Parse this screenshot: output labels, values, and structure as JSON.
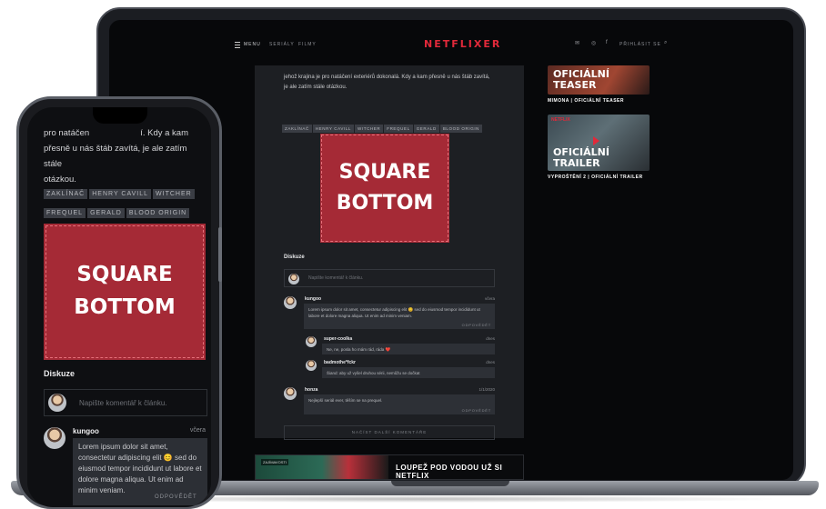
{
  "nav": {
    "menu_label": "MENU",
    "items": [
      "SERIÁLY",
      "FILMY"
    ],
    "logo": "NETFLIXER",
    "login_label": "PŘIHLÁSIT SE"
  },
  "article": {
    "paragraph": "jehož krajina je pro natáčení exteriérů dokonalá. Kdy a kam přesně u nás štáb zavítá, je ale zatím stále otázkou.",
    "tags": [
      "ZAKLÍNAČ",
      "HENRY CAVILL",
      "WITCHER",
      "FREQUEL",
      "GERALD",
      "BLOOD ORIGIN"
    ],
    "ad_line1": "SQUARE",
    "ad_line2": "BOTTOM"
  },
  "discussion": {
    "title": "Diskuze",
    "input_placeholder": "Napište komentář k článku.",
    "comments": [
      {
        "author": "kungoo",
        "time": "včera",
        "text": "Lorem ipsum dolor sit amet, consectetur adipiscing elit 😊 sed do eiusmod tempor incididunt ut labore et dolore magna aliqua. Ut enim ad minim veniam.",
        "reply_label": "ODPOVĚDĚT"
      },
      {
        "author": "super-coolka",
        "time": "dnes",
        "text": "Ne, ne, posla ho mám rád, ráda ❤️"
      },
      {
        "author": "badmothe*fckr",
        "time": "dnes",
        "text": "Šiand: aby už vyšel druhou sérii, nemůžu se dočkat"
      },
      {
        "author": "honza",
        "time": "1/1/2020",
        "text": "Nejlepší seriál ever, těším se na prequel.",
        "reply_label": "ODPOVĚDĚT"
      }
    ],
    "load_more_label": "NAČÍST DALŠÍ KOMENTÁŘE"
  },
  "sidebar": {
    "items": [
      {
        "overlay": "OFICIÁLNÍ TEASER",
        "caption": "MIMONA | OFICIÁLNÍ TEASER"
      },
      {
        "overlay": "OFICIÁLNÍ TRAILER",
        "badge": "NETFLIX",
        "caption": "VYPROŠTĚNÍ 2 | OFICIÁLNÍ TRAILER"
      }
    ]
  },
  "promo": {
    "label": "ZAJÍMAVOSTI",
    "title": "LOUPEŽ POD VODOU UŽ SI NETFLIX"
  },
  "phone": {
    "paragraph_line1": "pro natáčen",
    "paragraph_line1b": "í. Kdy a kam",
    "paragraph_line2": "přesně u nás štáb zavítá, je ale zatím stále",
    "paragraph_line3": "otázkou.",
    "tags": [
      "ZAKLÍNAČ",
      "HENRY CAVILL",
      "WITCHER",
      "FREQUEL",
      "GERALD",
      "BLOOD ORIGIN"
    ],
    "ad_line1": "SQUARE",
    "ad_line2": "BOTTOM",
    "discussion_title": "Diskuze",
    "input_placeholder": "Napište komentář k článku.",
    "comment_author": "kungoo",
    "comment_time": "včera",
    "comment_text": "Lorem ipsum dolor sit amet, consectetur adipiscing elit 😊 sed do eiusmod tempor incididunt ut labore et dolore magna aliqua. Ut enim ad minim veniam.",
    "reply_label": "ODPOVĚDĚT"
  },
  "colors": {
    "brand_red": "#e2293a",
    "ad_red": "#a52a36",
    "page_dark": "#07080a",
    "panel_dark": "#1d1f23"
  }
}
